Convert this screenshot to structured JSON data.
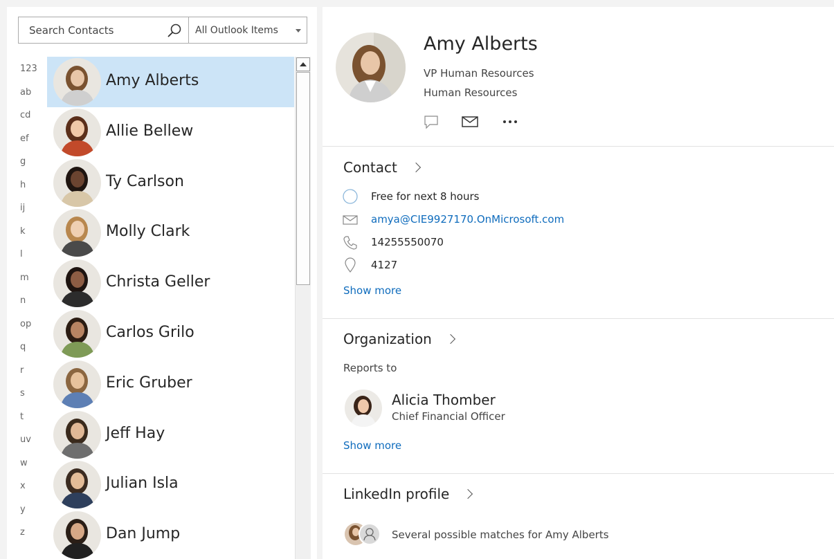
{
  "search": {
    "placeholder": "Search Contacts",
    "scope": "All Outlook Items"
  },
  "alphabet": [
    "123",
    "ab",
    "cd",
    "ef",
    "g",
    "h",
    "ij",
    "k",
    "l",
    "m",
    "n",
    "op",
    "q",
    "r",
    "s",
    "t",
    "uv",
    "w",
    "x",
    "y",
    "z"
  ],
  "contacts": [
    {
      "name": "Amy Alberts",
      "selected": true,
      "skin": "#e8c6a8",
      "hair": "#7a5230",
      "shirt": "#cfcfcf"
    },
    {
      "name": "Allie Bellew",
      "selected": false,
      "skin": "#f0c9a8",
      "hair": "#5b2f1a",
      "shirt": "#c24a2a"
    },
    {
      "name": "Ty Carlson",
      "selected": false,
      "skin": "#6b4430",
      "hair": "#1f1510",
      "shirt": "#d8c7a8"
    },
    {
      "name": "Molly Clark",
      "selected": false,
      "skin": "#efcfb2",
      "hair": "#b8874e",
      "shirt": "#4a4a4a"
    },
    {
      "name": "Christa Geller",
      "selected": false,
      "skin": "#8d5d44",
      "hair": "#1e1410",
      "shirt": "#2c2c2c"
    },
    {
      "name": "Carlos Grilo",
      "selected": false,
      "skin": "#b88462",
      "hair": "#2b1c12",
      "shirt": "#7e9a56"
    },
    {
      "name": "Eric Gruber",
      "selected": false,
      "skin": "#e7c29c",
      "hair": "#8b6640",
      "shirt": "#5d7fb4"
    },
    {
      "name": "Jeff Hay",
      "selected": false,
      "skin": "#e0b896",
      "hair": "#3a2a1c",
      "shirt": "#6e6e6e"
    },
    {
      "name": "Julian Isla",
      "selected": false,
      "skin": "#e3bc98",
      "hair": "#3b2b20",
      "shirt": "#2e3f5c"
    },
    {
      "name": "Dan Jump",
      "selected": false,
      "skin": "#d6a886",
      "hair": "#2a1e16",
      "shirt": "#202020"
    }
  ],
  "detail": {
    "name": "Amy Alberts",
    "title": "VP Human Resources",
    "department": "Human Resources",
    "contact_heading": "Contact",
    "availability": "Free for next 8 hours",
    "email": "amya@CIE9927170.OnMicrosoft.com",
    "phone": "14255550070",
    "office": "4127",
    "show_more": "Show more",
    "org_heading": "Organization",
    "reports_to": "Reports to",
    "manager_name": "Alicia Thomber",
    "manager_title": "Chief Financial Officer",
    "linkedin_heading": "LinkedIn profile",
    "linkedin_text": "Several possible matches for Amy Alberts"
  },
  "colors": {
    "selection": "#cce4f7",
    "link": "#0f6cbd"
  }
}
